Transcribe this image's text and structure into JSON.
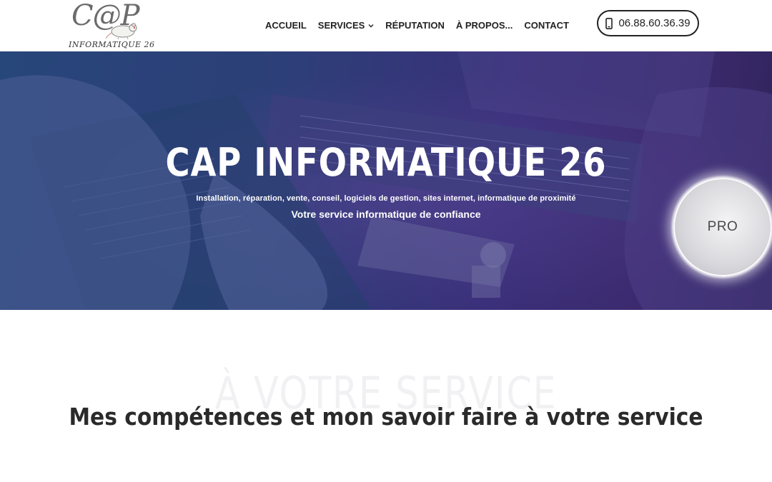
{
  "header": {
    "logo": {
      "main": "C@P",
      "sub": "INFORMATIQUE 26"
    },
    "nav": [
      {
        "label": "ACCUEIL"
      },
      {
        "label": "SERVICES",
        "has_dropdown": true
      },
      {
        "label": "RÉPUTATION"
      },
      {
        "label": "À PROPOS..."
      },
      {
        "label": "CONTACT"
      }
    ],
    "phone": {
      "icon": "mobile-phone-icon",
      "number": "06.88.60.36.39"
    }
  },
  "hero": {
    "title": "CAP INFORMATIQUE 26",
    "subtitle_line1": "Installation, réparation, vente, conseil, logiciels de gestion, sites internet, informatique de proximité",
    "subtitle_line2": "Votre service informatique de confiance",
    "badge": "PRO"
  },
  "section": {
    "ghost_text": "À VOTRE SERVICE",
    "title": "Mes compétences et mon savoir faire à votre service"
  },
  "colors": {
    "hero_left": "#27467a",
    "hero_right": "#3c2a6e",
    "text_dark": "#222222"
  }
}
